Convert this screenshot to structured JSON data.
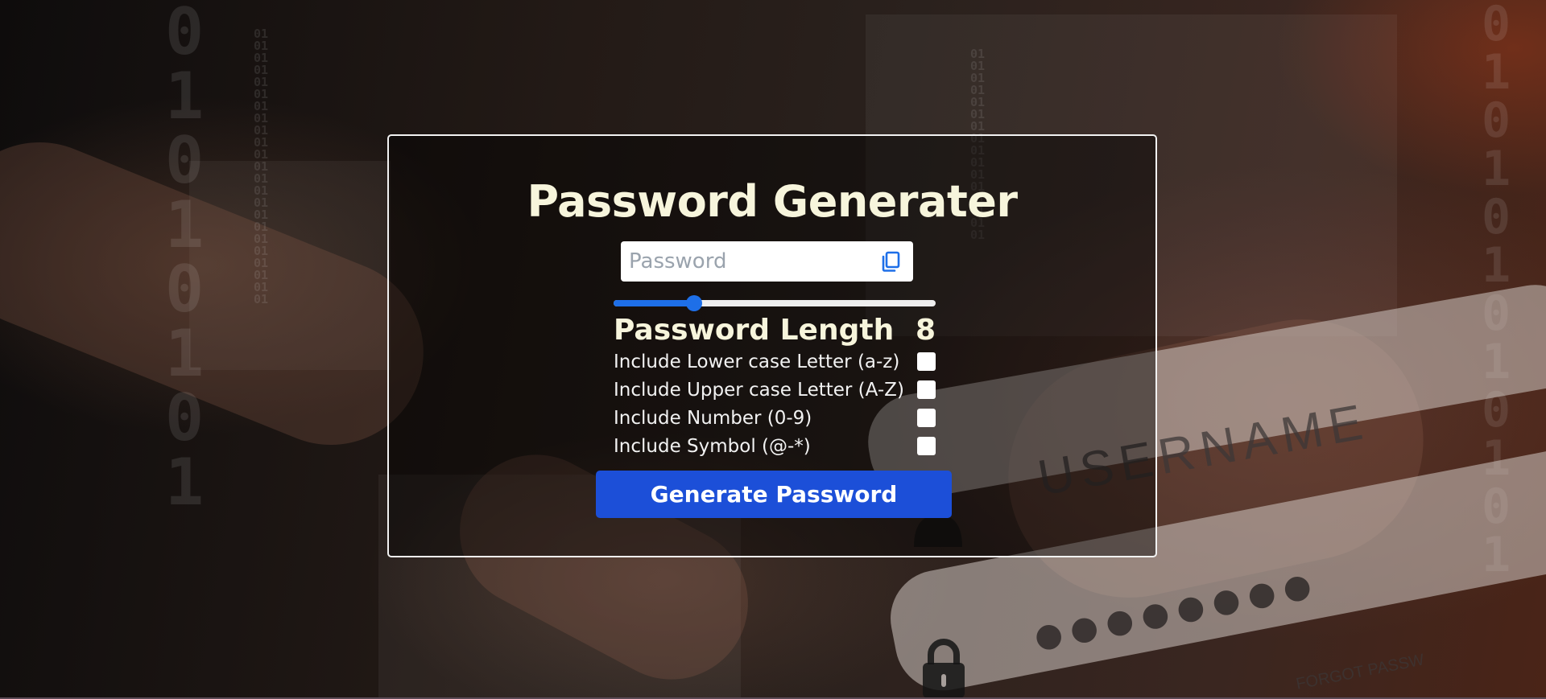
{
  "title": "Password Generater",
  "password_field": {
    "placeholder": "Password",
    "value": "",
    "copy_icon": "copy-icon"
  },
  "length": {
    "label": "Password Length",
    "value": "8",
    "slider_fraction": 0.25
  },
  "options": [
    {
      "label": "Include Lower case Letter (a-z)",
      "checked": false
    },
    {
      "label": "Include Upper case Letter (A-Z)",
      "checked": false
    },
    {
      "label": "Include Number (0-9)",
      "checked": false
    },
    {
      "label": "Include Symbol (@-*)",
      "checked": false
    }
  ],
  "generate_button": "Generate Password",
  "background": {
    "username_text": "USERNAME",
    "forgot_text": "FORGOT PASSW"
  },
  "colors": {
    "accent": "#1c4fd8",
    "slider": "#1e6fe8",
    "title_text": "#f7f5dc",
    "card_border": "#f2f2f2"
  }
}
